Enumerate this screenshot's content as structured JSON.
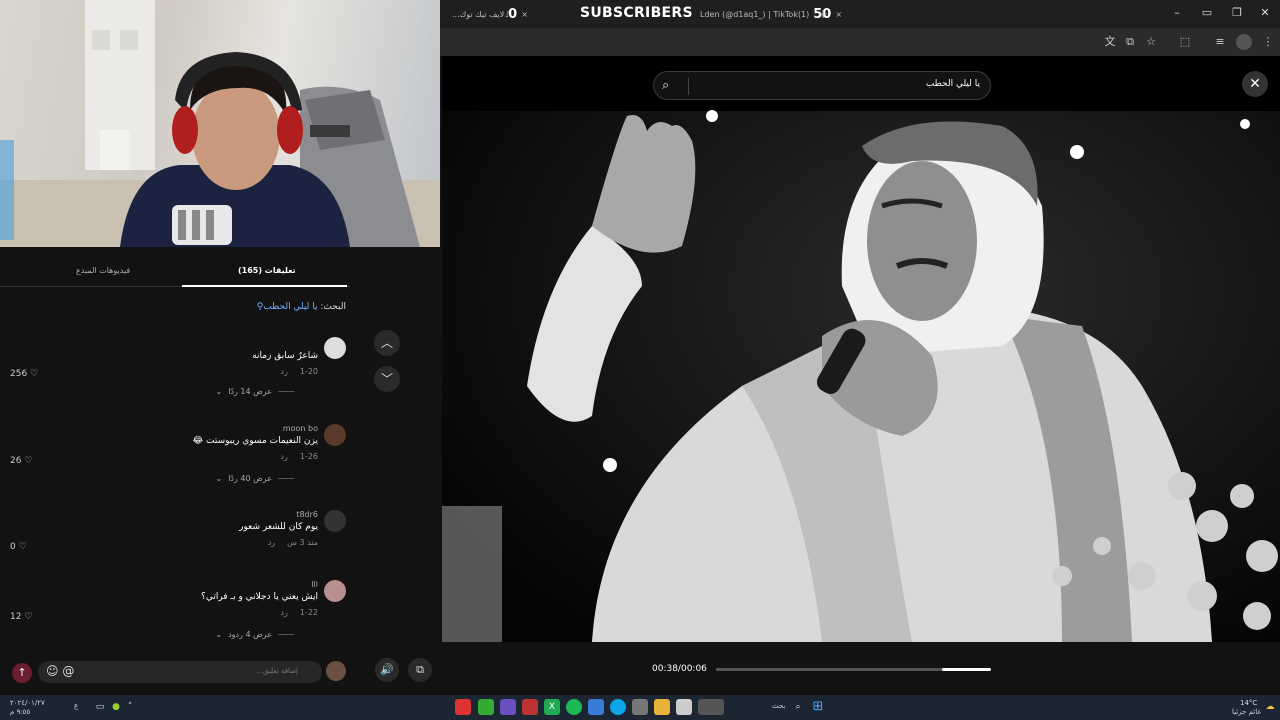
{
  "browser": {
    "tab_counter_left": "0",
    "tab_counter_right": "50",
    "subscribers_label": "SUBSCRIBERS",
    "tab_text_right": "Lden (@d1aq1_) | TikTok(1)",
    "tab_text_left": "...لايف تيك توك"
  },
  "panel": {
    "tab_comments": "(165) تعليقات",
    "tab_videos": "فيديوهات المبدع",
    "search_prefix": "البحث:",
    "search_query": "يا ليلي الحطب",
    "comments": [
      {
        "user": "",
        "text": "شاعرٌ سابق زمانه",
        "date": "1-20",
        "reply": "رد",
        "replies": "عرض 14 ردًا",
        "likes": "256 ♡"
      },
      {
        "user": "moon bo",
        "text": "يزن النعيمات مسوي ريبوستت 😂",
        "date": "1-26",
        "reply": "رد",
        "replies": "عرض 40 ردًا",
        "likes": "26 ♡"
      },
      {
        "user": "t8dr6",
        "text": "يوم كان للشعر شعور",
        "date": "منذ 3 س",
        "reply": "رد",
        "replies": "",
        "likes": "0 ♡"
      },
      {
        "user": "lll",
        "text": "ايش يعني يا دجلاني و بـ فراتي؟",
        "date": "1-22",
        "reply": "رد",
        "replies": "عرض 4 ردود",
        "likes": "12 ♡"
      }
    ],
    "comment_placeholder": "إضافة تعليق...",
    "emoji_icons": "☺ @"
  },
  "video": {
    "search_text": "يا ليلي الحطب",
    "time": "00:38/00:06",
    "progress": 0.18
  },
  "taskbar": {
    "weather": "14°C",
    "weather_sub": "غائم جزئيا",
    "clock": "٩:٥٥ م",
    "date": "٢٠٢٤/٠١/٢٧",
    "search_label": "بحث",
    "lang": "ع"
  },
  "colors": {
    "accent_blue": "#74b4ff",
    "send_button": "#6b1e2e"
  }
}
